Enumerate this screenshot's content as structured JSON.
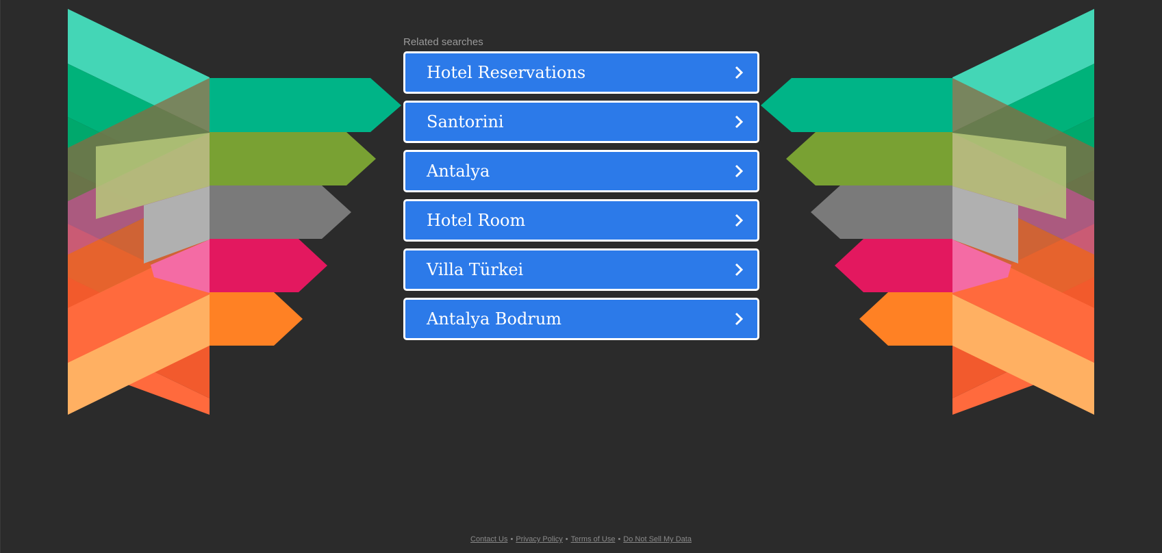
{
  "related": {
    "heading": "Related searches",
    "items": [
      {
        "label": "Hotel Reservations"
      },
      {
        "label": "Santorini"
      },
      {
        "label": "Antalya"
      },
      {
        "label": "Hotel Room"
      },
      {
        "label": "Villa Türkei"
      },
      {
        "label": "Antalya Bodrum"
      }
    ],
    "button_color": "#2c7ae9",
    "chevron_icon": "chevron-right-icon"
  },
  "footer": {
    "links": [
      "Contact Us",
      "Privacy Policy",
      "Terms of Use",
      "Do Not Sell My Data"
    ],
    "separator": "•"
  },
  "decoration": {
    "background_color": "#2b2b2b",
    "ribbon_colors": [
      "#00b487",
      "#79a133",
      "#7a7a7a",
      "#e3185f",
      "#ff8124"
    ]
  }
}
